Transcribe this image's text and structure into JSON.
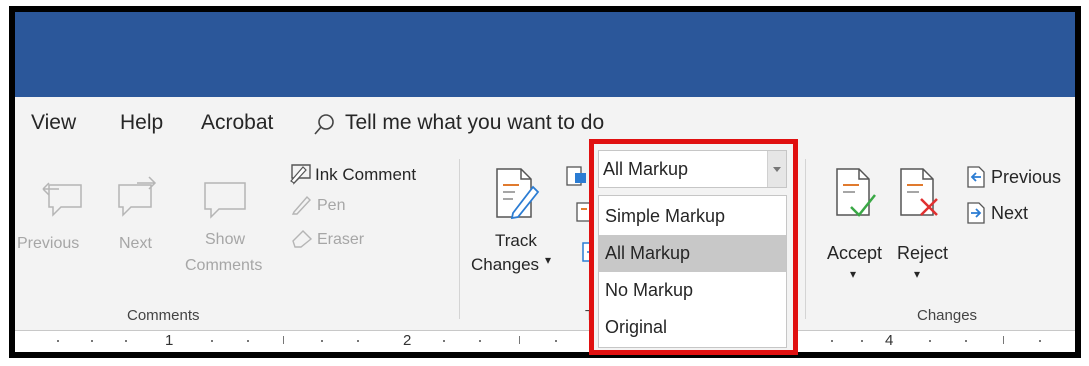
{
  "tabs": {
    "view": "View",
    "help": "Help",
    "acrobat": "Acrobat",
    "tell_me": "Tell me what you want to do"
  },
  "comments_group": {
    "previous": "Previous",
    "next": "Next",
    "show": "Show",
    "comments": "Comments",
    "ink_comment": "Ink Comment",
    "pen": "Pen",
    "eraser": "Eraser",
    "group_label": "Comments"
  },
  "tracking_group": {
    "track": "Track",
    "changes": "Changes",
    "group_label_fragment": "T"
  },
  "markup_dropdown": {
    "selected": "All Markup",
    "options": [
      "Simple Markup",
      "All Markup",
      "No Markup",
      "Original"
    ],
    "highlighted_index": 1
  },
  "changes_group": {
    "accept": "Accept",
    "reject": "Reject",
    "previous": "Previous",
    "next": "Next",
    "group_label": "Changes"
  },
  "ruler": {
    "labels": [
      "1",
      "2",
      "4"
    ]
  },
  "colors": {
    "title_bar": "#2b579a",
    "highlight_border": "#e01010",
    "accept_check": "#3aa845",
    "reject_x": "#e03030",
    "doc_icon_accent": "#2b7cd3"
  },
  "icons": [
    "previous-comment-icon",
    "next-comment-icon",
    "show-comments-icon",
    "ink-comment-icon",
    "pen-icon",
    "eraser-icon",
    "track-changes-icon",
    "accept-icon",
    "reject-icon",
    "previous-change-icon",
    "next-change-icon",
    "search-icon"
  ]
}
